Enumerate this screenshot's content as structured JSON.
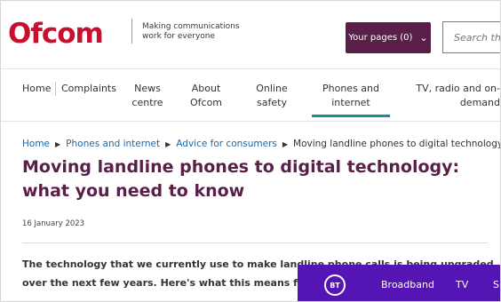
{
  "header": {
    "logo_text": "Ofcom",
    "tagline": "Making communications work for everyone",
    "your_pages_label": "Your pages (0)",
    "search_placeholder": "Search the O"
  },
  "nav": {
    "items": [
      {
        "label": "Home"
      },
      {
        "label": "Complaints"
      },
      {
        "label": "News centre"
      },
      {
        "label": "About Ofcom"
      },
      {
        "label": "Online safety"
      },
      {
        "label": "Phones and internet"
      },
      {
        "label": "TV, radio and on-demand"
      }
    ],
    "active": "Phones and internet"
  },
  "breadcrumb": {
    "items": [
      "Home",
      "Phones and internet",
      "Advice for consumers"
    ],
    "current": "Moving landline phones to digital technology"
  },
  "article": {
    "title": "Moving landline phones to digital technology: what you need to know",
    "date": "16 January 2023",
    "intro": "The technology that we currently use to make landline phone calls is being upgraded over the next few years. Here's what this means for you as a customer."
  },
  "ad": {
    "logo": "BT",
    "links": [
      "Broadband",
      "TV",
      "S"
    ],
    "background_color": "#5514b4"
  },
  "colors": {
    "brand": "#5a1f48",
    "accent": "#1a8e93",
    "link": "#1d67a8"
  }
}
